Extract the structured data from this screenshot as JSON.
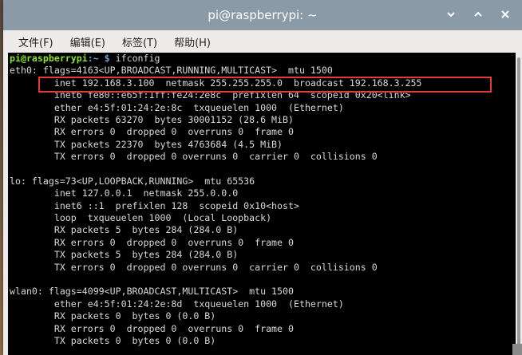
{
  "window": {
    "title": "pi@raspberrypi: ~"
  },
  "titlebar_buttons": {
    "minimize_icon": "chevron-down-icon",
    "maximize_icon": "chevron-up-icon",
    "close_icon": "close-icon"
  },
  "menu": {
    "items": [
      "文件(F)",
      "编辑(E)",
      "标签(T)",
      "帮助(H)"
    ]
  },
  "terminal": {
    "prompt_user": "pi@raspberrypi",
    "prompt_path": ":~ $",
    "command": " ifconfig",
    "lines": [
      "eth0: flags=4163<UP,BROADCAST,RUNNING,MULTICAST>  mtu 1500",
      "        inet 192.168.3.100  netmask 255.255.255.0  broadcast 192.168.3.255",
      "        inet6 fe80::e65f:1ff:fe24:2e8c  prefixlen 64  scopeid 0x20<link>",
      "        ether e4:5f:01:24:2e:8c  txqueuelen 1000  (Ethernet)",
      "        RX packets 63270  bytes 30001152 (28.6 MiB)",
      "        RX errors 0  dropped 0  overruns 0  frame 0",
      "        TX packets 22370  bytes 4763684 (4.5 MiB)",
      "        TX errors 0  dropped 0 overruns 0  carrier 0  collisions 0",
      "",
      "lo: flags=73<UP,LOOPBACK,RUNNING>  mtu 65536",
      "        inet 127.0.0.1  netmask 255.0.0.0",
      "        inet6 ::1  prefixlen 128  scopeid 0x10<host>",
      "        loop  txqueuelen 1000  (Local Loopback)",
      "        RX packets 5  bytes 284 (284.0 B)",
      "        RX errors 0  dropped 0  overruns 0  frame 0",
      "        TX packets 5  bytes 284 (284.0 B)",
      "        TX errors 0  dropped 0 overruns 0  carrier 0  collisions 0",
      "",
      "wlan0: flags=4099<UP,BROADCAST,MULTICAST>  mtu 1500",
      "        ether e4:5f:01:24:2e:8d  txqueuelen 1000  (Ethernet)",
      "        RX packets 0  bytes 0 (0.0 B)",
      "        RX errors 0  dropped 0  overruns 0  frame 0",
      "        TX packets 0  bytes 0 (0.0 B)"
    ]
  },
  "colors": {
    "titlebar": "#8b9aa7",
    "terminal_bg": "#000000",
    "terminal_fg": "#d9d9d9",
    "prompt_user": "#8ae234",
    "prompt_path": "#729fcf",
    "highlight_box": "#e53935"
  }
}
